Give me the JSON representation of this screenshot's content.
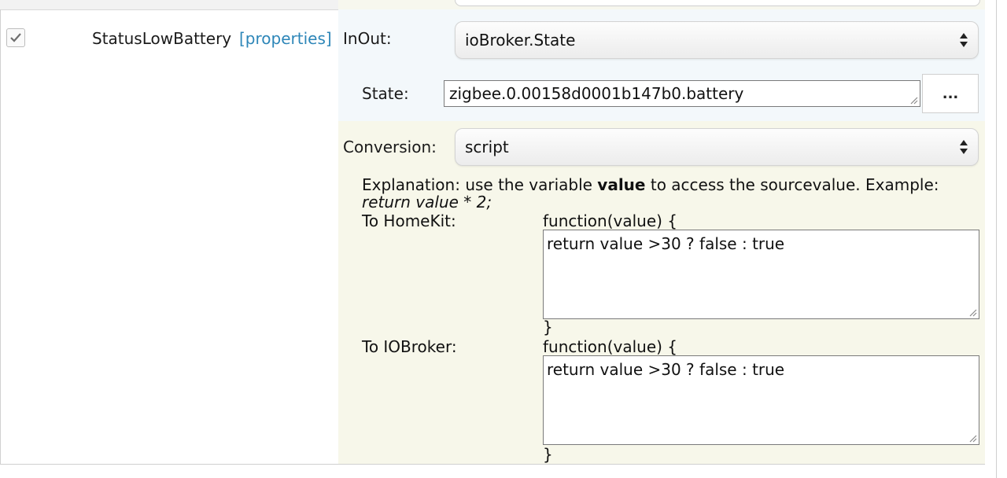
{
  "row": {
    "name": "StatusLowBattery",
    "properties_link": "[properties]",
    "checked": true
  },
  "inout": {
    "label": "InOut:",
    "value": "ioBroker.State"
  },
  "state": {
    "label": "State:",
    "value": "zigbee.0.00158d0001b147b0.battery",
    "browse_label": "..."
  },
  "conversion": {
    "label": "Conversion:",
    "value": "script",
    "explanation_prefix": "Explanation: use the variable ",
    "explanation_var": "value",
    "explanation_suffix": " to access the sourcevalue. Example:",
    "example_code": "return value * 2;",
    "to_homekit": {
      "label": "To HomeKit:",
      "func_open": "function(value) {",
      "code": "return value >30 ? false : true",
      "func_close": "}"
    },
    "to_iobroker": {
      "label": "To IOBroker:",
      "func_open": "function(value) {",
      "code": "return value >30 ? false : true",
      "func_close": "}"
    }
  },
  "colors": {
    "link": "#2d86b8",
    "panel_blue": "#f3f8fb",
    "panel_cream": "#f7f7ea"
  }
}
